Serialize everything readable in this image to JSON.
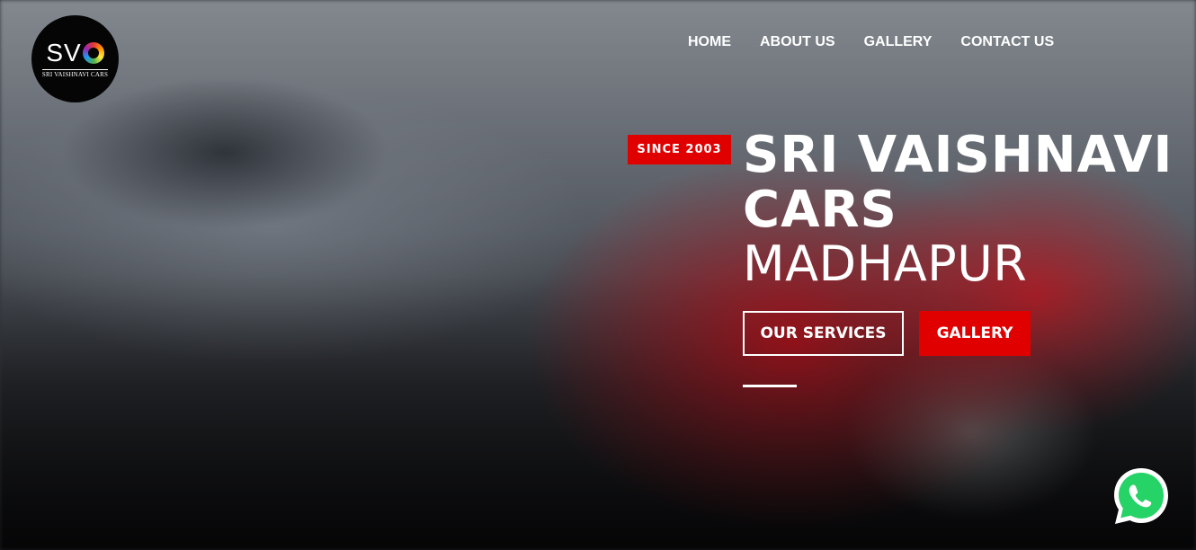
{
  "brand": {
    "logo_mark": "SV",
    "logo_text": "SRI VAISHNAVI CARS"
  },
  "nav": {
    "items": [
      "HOME",
      "ABOUT US",
      "GALLERY",
      "CONTACT US"
    ]
  },
  "hero": {
    "badge": "SINCE 2003",
    "title_line1": "SRI VAISHNAVI",
    "title_line2": "CARS",
    "title_line3": "MADHAPUR",
    "services_button": "OUR SERVICES",
    "gallery_button": "GALLERY"
  },
  "colors": {
    "accent": "#e10000",
    "text": "#ffffff",
    "whatsapp": "#25d366"
  },
  "icons": {
    "floating": "whatsapp-icon"
  }
}
